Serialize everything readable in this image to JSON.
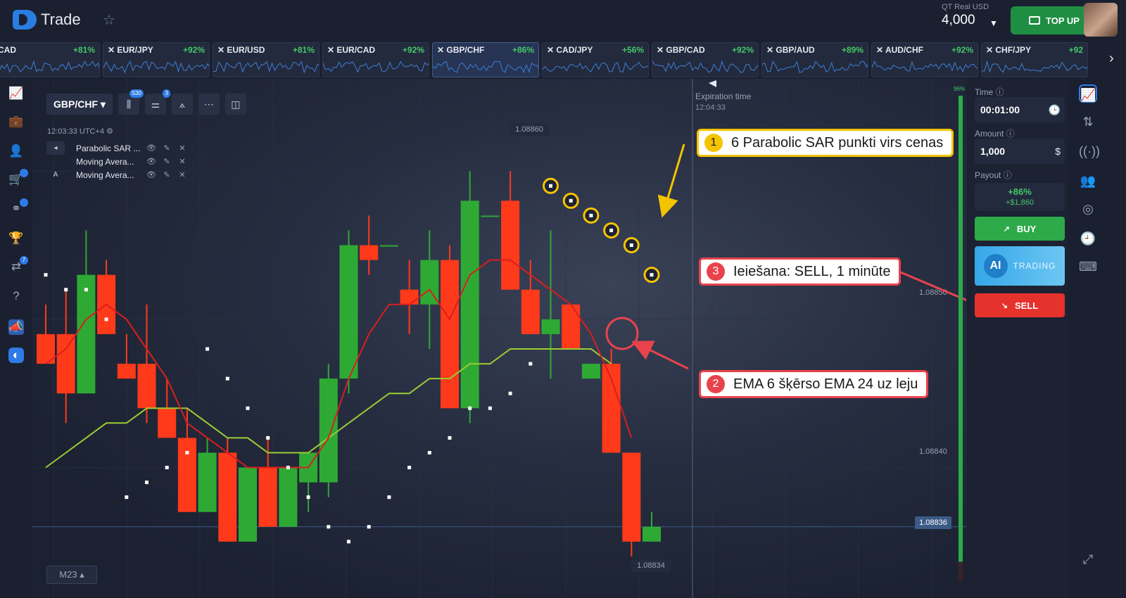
{
  "app": {
    "name": "Trade"
  },
  "account": {
    "label": "QT Real  USD",
    "balance": "4,000",
    "topup_label": "TOP UP"
  },
  "tickers": [
    {
      "pair": "CAD",
      "payout": "+81%"
    },
    {
      "pair": "EUR/JPY",
      "payout": "+92%"
    },
    {
      "pair": "EUR/USD",
      "payout": "+81%"
    },
    {
      "pair": "EUR/CAD",
      "payout": "+92%"
    },
    {
      "pair": "GBP/CHF",
      "payout": "+86%"
    },
    {
      "pair": "CAD/JPY",
      "payout": "+56%"
    },
    {
      "pair": "GBP/CAD",
      "payout": "+92%"
    },
    {
      "pair": "GBP/AUD",
      "payout": "+89%"
    },
    {
      "pair": "AUD/CHF",
      "payout": "+92%"
    },
    {
      "pair": "CHF/JPY",
      "payout": "+92"
    }
  ],
  "toolbar": {
    "pair": "GBP/CHF",
    "badge_candles": "S30",
    "badge_indicators": "3"
  },
  "chart_clock": "12:03:33 UTC+4",
  "indicators": [
    {
      "name": "Parabolic SAR ...",
      "lead": "◂"
    },
    {
      "name": "Moving Avera...",
      "lead": ""
    },
    {
      "name": "Moving Avera...",
      "lead": "A"
    }
  ],
  "expiration": {
    "label": "Expiration time",
    "time": "12:04:33"
  },
  "price_axis": {
    "hi": "1.08860",
    "p850": "1.08850",
    "p840": "1.08840",
    "current": "1.08836",
    "low": "1.08834"
  },
  "timeframe": "M23",
  "callouts": {
    "c1": {
      "num": "1",
      "text": "6 Parabolic SAR punkti virs cenas"
    },
    "c2": {
      "num": "2",
      "text": "EMA 6 šķērso EMA 24 uz leju"
    },
    "c3": {
      "num": "3",
      "text": "Ieiešana: SELL, 1 minūte"
    }
  },
  "panel": {
    "time_label": "Time",
    "time_value": "00:01:00",
    "amount_label": "Amount",
    "amount_value": "1,000",
    "payout_label": "Payout",
    "payout_pct": "+86%",
    "payout_amount": "+$1,860",
    "buy_label": "BUY",
    "ai_label": "AI",
    "ai_trading": "TRADING",
    "sell_label": "SELL",
    "bar_pct": "96%"
  },
  "colors": {
    "bull": "#2eaa34",
    "bear": "#ff3a1a",
    "ema_fast": "#d81e1e",
    "ema_slow": "#9acd32",
    "accent": "#2f7be6"
  },
  "chart_data": {
    "type": "candlestick",
    "ylim": [
      1.08833,
      1.08863
    ],
    "candles": [
      {
        "o": 1.08849,
        "h": 1.08851,
        "l": 1.08847,
        "c": 1.08847
      },
      {
        "o": 1.08849,
        "h": 1.08852,
        "l": 1.08843,
        "c": 1.08845
      },
      {
        "o": 1.08845,
        "h": 1.08856,
        "l": 1.08845,
        "c": 1.08853
      },
      {
        "o": 1.08853,
        "h": 1.08854,
        "l": 1.08849,
        "c": 1.08849
      },
      {
        "o": 1.08847,
        "h": 1.08849,
        "l": 1.08846,
        "c": 1.08846
      },
      {
        "o": 1.08847,
        "h": 1.08851,
        "l": 1.08843,
        "c": 1.08844
      },
      {
        "o": 1.08844,
        "h": 1.08846,
        "l": 1.08842,
        "c": 1.08842
      },
      {
        "o": 1.08842,
        "h": 1.08844,
        "l": 1.08837,
        "c": 1.08837
      },
      {
        "o": 1.08837,
        "h": 1.08842,
        "l": 1.08837,
        "c": 1.08841
      },
      {
        "o": 1.08841,
        "h": 1.08842,
        "l": 1.08835,
        "c": 1.08835
      },
      {
        "o": 1.08835,
        "h": 1.0884,
        "l": 1.08835,
        "c": 1.0884
      },
      {
        "o": 1.0884,
        "h": 1.08842,
        "l": 1.08836,
        "c": 1.08836
      },
      {
        "o": 1.08836,
        "h": 1.0884,
        "l": 1.08836,
        "c": 1.0884
      },
      {
        "o": 1.08839,
        "h": 1.08841,
        "l": 1.08837,
        "c": 1.08841
      },
      {
        "o": 1.08839,
        "h": 1.08847,
        "l": 1.08838,
        "c": 1.08846
      },
      {
        "o": 1.08846,
        "h": 1.08856,
        "l": 1.08845,
        "c": 1.08855
      },
      {
        "o": 1.08855,
        "h": 1.08857,
        "l": 1.08853,
        "c": 1.08854
      },
      {
        "o": 1.08855,
        "h": 1.08855,
        "l": 1.08855,
        "c": 1.08855
      },
      {
        "o": 1.08852,
        "h": 1.08854,
        "l": 1.08849,
        "c": 1.08851
      },
      {
        "o": 1.08851,
        "h": 1.08856,
        "l": 1.08848,
        "c": 1.08854
      },
      {
        "o": 1.08854,
        "h": 1.08855,
        "l": 1.08844,
        "c": 1.08844
      },
      {
        "o": 1.08844,
        "h": 1.0886,
        "l": 1.08843,
        "c": 1.08858
      },
      {
        "o": 1.08857,
        "h": 1.08857,
        "l": 1.08857,
        "c": 1.08857
      },
      {
        "o": 1.08858,
        "h": 1.0886,
        "l": 1.08852,
        "c": 1.08852
      },
      {
        "o": 1.08852,
        "h": 1.08854,
        "l": 1.08849,
        "c": 1.08849
      },
      {
        "o": 1.08849,
        "h": 1.08856,
        "l": 1.08846,
        "c": 1.0885
      },
      {
        "o": 1.08851,
        "h": 1.08851,
        "l": 1.08848,
        "c": 1.08848
      },
      {
        "o": 1.08846,
        "h": 1.08847,
        "l": 1.08846,
        "c": 1.08847
      },
      {
        "o": 1.08847,
        "h": 1.08848,
        "l": 1.08841,
        "c": 1.08841
      },
      {
        "o": 1.08841,
        "h": 1.08841,
        "l": 1.08834,
        "c": 1.08835
      },
      {
        "o": 1.08835,
        "h": 1.08837,
        "l": 1.08835,
        "c": 1.08836
      }
    ],
    "ema_fast": [
      1.08847,
      1.08848,
      1.0885,
      1.08851,
      1.0885,
      1.08848,
      1.08846,
      1.08843,
      1.08842,
      1.08841,
      1.0884,
      1.0884,
      1.0884,
      1.0884,
      1.08842,
      1.08846,
      1.08849,
      1.08851,
      1.08851,
      1.08852,
      1.0885,
      1.08853,
      1.08854,
      1.08854,
      1.08853,
      1.08852,
      1.08851,
      1.08849,
      1.08846,
      1.08842
    ],
    "ema_slow": [
      1.0884,
      1.08841,
      1.08842,
      1.08843,
      1.08843,
      1.08844,
      1.08844,
      1.08844,
      1.08843,
      1.08842,
      1.08842,
      1.08841,
      1.08841,
      1.08841,
      1.08842,
      1.08843,
      1.08844,
      1.08845,
      1.08845,
      1.08846,
      1.08846,
      1.08847,
      1.08847,
      1.08848,
      1.08848,
      1.08848,
      1.08848,
      1.08848,
      1.08847
    ],
    "sar": [
      1.08853,
      1.08852,
      1.08852,
      1.0885,
      1.08838,
      1.08839,
      1.0884,
      1.08841,
      1.08848,
      1.08846,
      1.08844,
      1.08842,
      1.0884,
      1.08838,
      1.08836,
      1.08835,
      1.08836,
      1.08838,
      1.0884,
      1.08841,
      1.08842,
      1.08844,
      1.08844,
      1.08845,
      1.08847,
      1.08859,
      1.08858,
      1.08857,
      1.08856,
      1.08855,
      1.08853
    ]
  }
}
